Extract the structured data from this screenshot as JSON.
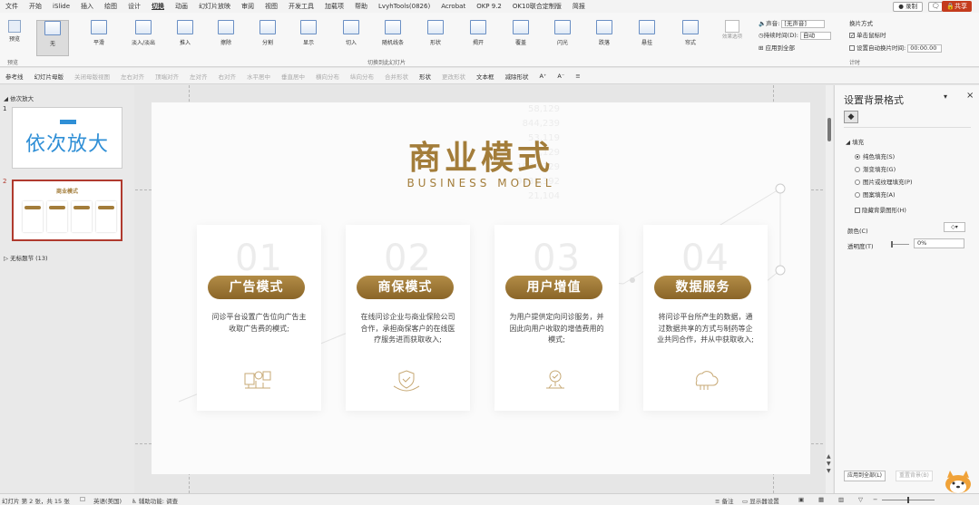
{
  "menu": [
    "文件",
    "开始",
    "iSlide",
    "插入",
    "绘图",
    "设计",
    "切换",
    "动画",
    "幻灯片放映",
    "审阅",
    "视图",
    "开发工具",
    "加载项",
    "帮助",
    "LvyhTools(0826)",
    "Acrobat",
    "OKP 9.2",
    "OK10联合定制版",
    "简报"
  ],
  "menu_active_index": 6,
  "top_right": {
    "record": "● 录制",
    "comment": "🗨",
    "share": "🔒共享"
  },
  "ribbon": {
    "preview_label": "预览",
    "preview_group": "预览",
    "transitions_group": "切换到此幻灯片",
    "timing_group": "计时",
    "transitions": [
      "无",
      "平滑",
      "淡入/淡出",
      "推入",
      "擦除",
      "分割",
      "显示",
      "切入",
      "随机线条",
      "形状",
      "揭开",
      "覆盖",
      "闪光",
      "跌落",
      "悬挂",
      "帘式"
    ],
    "effect_options": "效果选项",
    "sound_label": "声音:",
    "sound_value": "[无声音]",
    "duration_label": "持续时间(D):",
    "duration_value": "自动",
    "apply_all": "应用到全部",
    "advance_label": "换片方式",
    "on_click": "单击鼠标时",
    "after_label": "设置自动换片时间:",
    "after_value": "00:00.00"
  },
  "toolbar2": [
    "参考线",
    "幻灯片母版",
    "关闭母版视图",
    "左右对齐",
    "顶端对齐",
    "左对齐",
    "右对齐",
    "水平居中",
    "垂直居中",
    "横向分布",
    "纵向分布",
    "合并形状",
    "形状",
    "更改形状",
    "文本框",
    "减除形状",
    "A⁺",
    "A⁻",
    "≡"
  ],
  "toolbar2_dim": [
    2,
    3,
    4,
    5,
    6,
    7,
    8,
    9,
    10,
    11,
    13
  ],
  "left_panel": {
    "section1": "依次放大",
    "slide1_num": "1",
    "slide1_title": "依次放大",
    "slide2_num": "2",
    "section2": "无标题节 (13)"
  },
  "slide": {
    "title": "商业模式",
    "subtitle": "BUSINESS  MODEL",
    "cards": [
      {
        "num": "01",
        "title": "广告模式",
        "desc": "问诊平台设置广告位向广告主收取广告费的模式;"
      },
      {
        "num": "02",
        "title": "商保模式",
        "desc": "在线问诊企业与商业保险公司合作，承担商保客户的在线医疗服务进而获取收入;"
      },
      {
        "num": "03",
        "title": "用户增值",
        "desc": "为用户提供定向问诊服务，并因此向用户收取的增值费用的模式;"
      },
      {
        "num": "04",
        "title": "数据服务",
        "desc": "将问诊平台所产生的数据，通过数据共享的方式与制药等企业共同合作，并从中获取收入;"
      }
    ],
    "bg_numbers": [
      "58,129",
      "844,239",
      "53,119",
      "8,129",
      "1946,329",
      "9431,392",
      "21,104"
    ]
  },
  "right_panel": {
    "title": "设置背景格式",
    "fill_section": "填充",
    "options": [
      "纯色填充(S)",
      "渐变填充(G)",
      "图片或纹理填充(P)",
      "图案填充(A)"
    ],
    "selected": 0,
    "hide_bg": "隐藏背景图形(H)",
    "color_label": "颜色(C)",
    "transparency_label": "透明度(T)",
    "transparency_value": "0%",
    "apply_all": "应用到全部(L)",
    "reset": "重置背景(B)"
  },
  "status": {
    "slide_info": "幻灯片 第 2 张，共 15 张",
    "language": "英语(美国)",
    "accessibility": "辅助功能: 调查",
    "notes": "备注",
    "display": "显示器设置"
  },
  "colors": {
    "accent_red": "#c43b1d",
    "gold": "#a37d3a",
    "blue_title": "#2f8fd6"
  }
}
